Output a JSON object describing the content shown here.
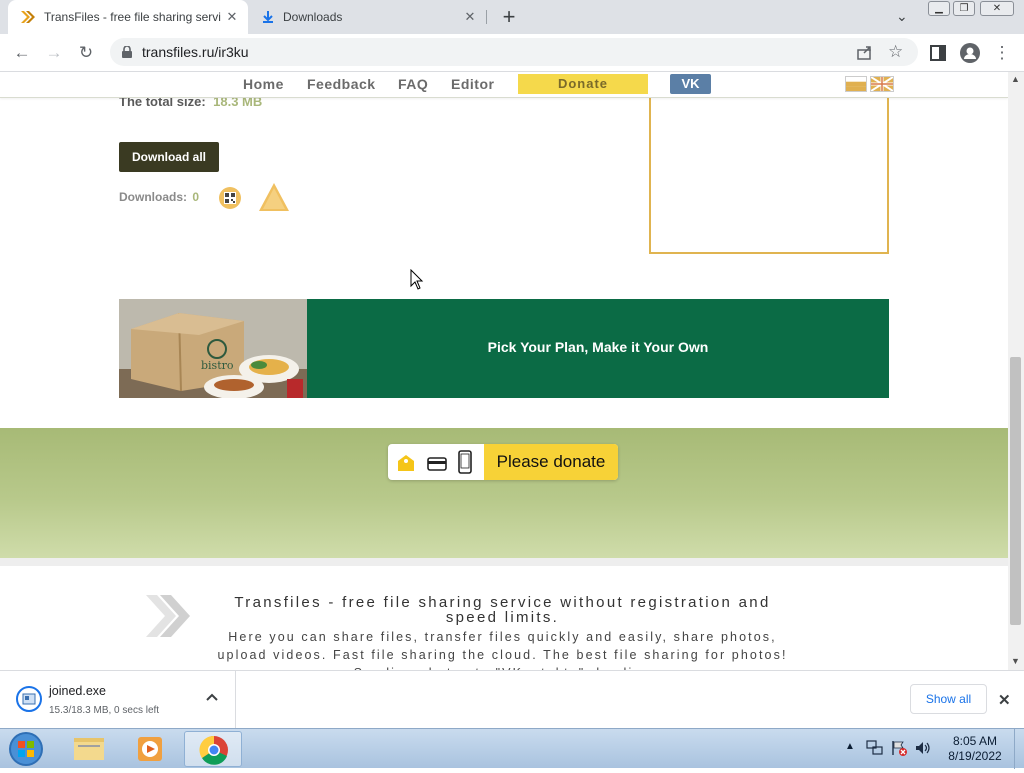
{
  "browser": {
    "tabs": [
      {
        "title": "TransFiles - free file sharing servi",
        "active": true
      },
      {
        "title": "Downloads",
        "active": false
      }
    ],
    "url": "transfiles.ru/ir3ku",
    "window_controls": [
      "minimize",
      "restore",
      "close"
    ]
  },
  "site_nav": {
    "items": [
      "Home",
      "Feedback",
      "FAQ",
      "Editor"
    ],
    "donate": "Donate",
    "vk": "VK"
  },
  "file_info": {
    "total_size_label": "The total size:",
    "total_size_value": "18.3 MB",
    "download_all": "Download all",
    "downloads_label": "Downloads:",
    "downloads_count": "0"
  },
  "ad_banner": {
    "brand": "bistroMD",
    "text": "Pick Your Plan, Make it Your Own"
  },
  "donate_widget": {
    "button": "Please donate"
  },
  "footer": {
    "title": "Transfiles - free file sharing service without registration and speed limits.",
    "text": "Here you can share files, transfer files quickly and easily, share photos, upload videos. Fast file sharing the cloud. The best file sharing for photos! Sending photos to \"VKontakte\", loading"
  },
  "download_bar": {
    "file_name": "joined.exe",
    "status": "15.3/18.3 MB, 0 secs left",
    "show_all": "Show all"
  },
  "taskbar": {
    "time": "8:05 AM",
    "date": "8/19/2022"
  },
  "colors": {
    "nav_donate": "#f5d94b",
    "vk": "#5b7fa6",
    "banner_green": "#0b6b45",
    "size_value": "#a9b77a",
    "donate_button": "#f7d237"
  }
}
